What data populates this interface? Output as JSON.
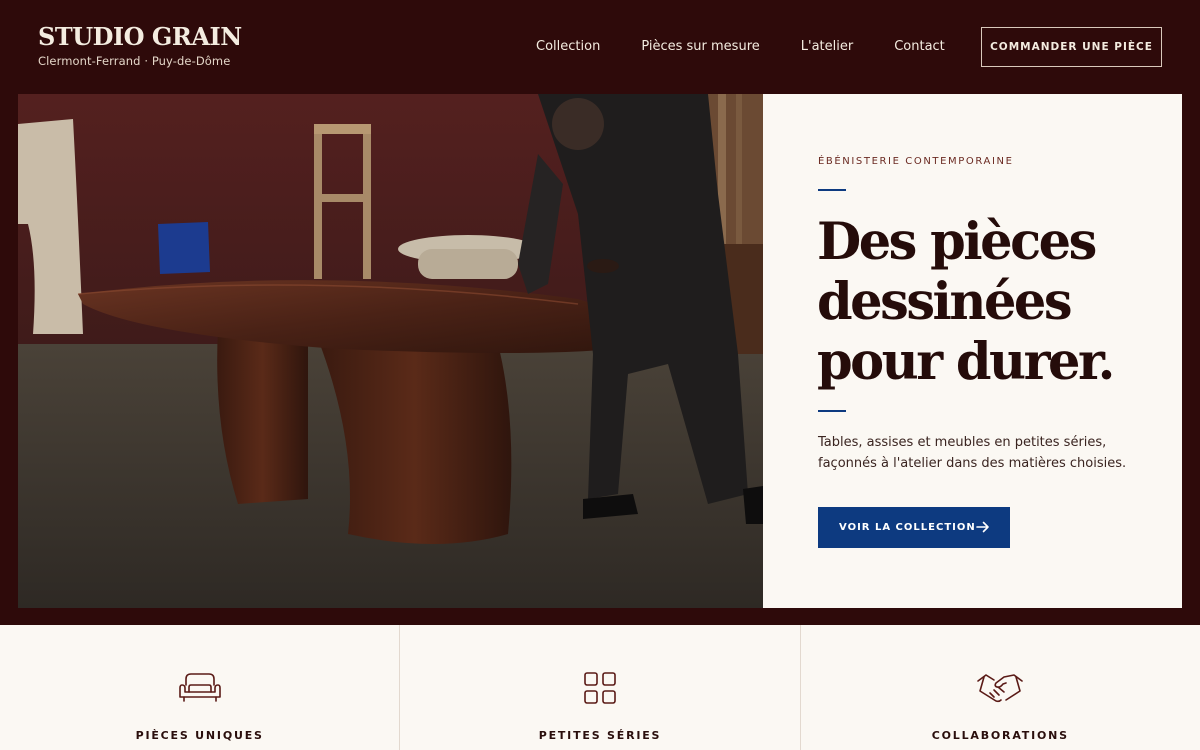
{
  "brand": {
    "name": "STUDIO GRAIN",
    "location": "Clermont-Ferrand · Puy-de-Dôme"
  },
  "nav": {
    "items": [
      {
        "label": "Collection"
      },
      {
        "label": "Pièces sur mesure"
      },
      {
        "label": "L'atelier"
      },
      {
        "label": "Contact"
      }
    ],
    "cta_label": "COMMANDER UNE PIÈCE"
  },
  "hero": {
    "eyebrow": "ÉBÉNISTERIE CONTEMPORAINE",
    "headline": "Des pièces dessinées pour durer.",
    "lede": "Tables, assises et meubles en petites séries, façonnés à l'atelier dans des matières choisies.",
    "cta_label": "VOIR LA COLLECTION",
    "cta_icon": "arrow-right-icon"
  },
  "features": [
    {
      "label": "PIÈCES UNIQUES",
      "icon": "armchair-icon"
    },
    {
      "label": "PETITES SÉRIES",
      "icon": "grid-icon"
    },
    {
      "label": "COLLABORATIONS",
      "icon": "handshake-icon"
    }
  ],
  "colors": {
    "background": "#2e0a0a",
    "panel": "#fbf8f3",
    "accent": "#0d3a80",
    "heading": "#250c0a"
  }
}
